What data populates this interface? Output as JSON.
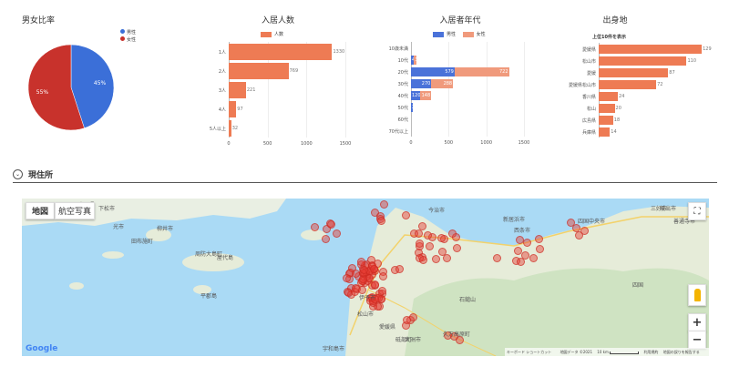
{
  "colors": {
    "male": "#3b6fd8",
    "female": "#c8322c",
    "bar": "#ee7b54",
    "bar_light": "#f09a7c",
    "series_blue": "#4a72d9"
  },
  "gender_panel": {
    "title": "男女比率",
    "legend": [
      "男性",
      "女性"
    ],
    "male_pct_label": "45%",
    "female_pct_label": "55%"
  },
  "residents_panel": {
    "title": "入居人数",
    "legend": "人数"
  },
  "age_panel": {
    "title": "入居者年代",
    "legend": [
      "男性",
      "女性"
    ]
  },
  "origin_panel": {
    "title": "出身地",
    "subtitle": "上位10件を表示"
  },
  "section": {
    "title": "現住所"
  },
  "map": {
    "tab_map": "地図",
    "tab_satellite": "航空写真",
    "google": "Google",
    "footer": [
      "キーボード ショートカット",
      "地図データ ©2021",
      "10 km",
      "利用規約",
      "地図の誤りを報告する"
    ],
    "places": [
      "山口県",
      "下松市",
      "光市",
      "田布施町",
      "柳井市",
      "周防大島町",
      "屋代島",
      "平郡島",
      "松山市",
      "西条市",
      "新居浜市",
      "四国中央市",
      "三好市",
      "愛媛県",
      "石鎚山",
      "今治市",
      "大洲市",
      "久万高原町",
      "四国",
      "坂出市",
      "善通寺市",
      "伊予市",
      "砥部町",
      "宇和島市"
    ]
  },
  "chart_data": [
    {
      "type": "pie",
      "title": "男女比率",
      "labels": [
        "男性",
        "女性"
      ],
      "values": [
        45,
        55
      ]
    },
    {
      "type": "bar",
      "title": "入居人数",
      "orientation": "horizontal",
      "categories": [
        "1人",
        "2人",
        "3人",
        "4人",
        "5人以上"
      ],
      "values": [
        1330,
        769,
        221,
        97,
        32
      ],
      "xlim": [
        0,
        1500
      ],
      "xticks": [
        0,
        500,
        1000,
        1500
      ],
      "series": [
        {
          "name": "人数"
        }
      ]
    },
    {
      "type": "bar",
      "title": "入居者年代",
      "orientation": "horizontal",
      "stacked": true,
      "categories": [
        "10歳未満",
        "10代",
        "20代",
        "30代",
        "40代",
        "50代",
        "60代",
        "70代以上"
      ],
      "series": [
        {
          "name": "男性",
          "values": [
            0,
            41,
            579,
            270,
            120,
            20,
            0,
            0
          ]
        },
        {
          "name": "女性",
          "values": [
            0,
            37,
            722,
            288,
            148,
            0,
            0,
            0
          ]
        }
      ],
      "xlim": [
        0,
        1500
      ],
      "xticks": [
        0,
        500,
        1000,
        1500
      ]
    },
    {
      "type": "bar",
      "title": "出身地",
      "orientation": "horizontal",
      "categories": [
        "愛媛県",
        "松山市",
        "愛媛",
        "愛媛県松山市",
        "香川県",
        "松山",
        "広島県",
        "兵庫県"
      ],
      "values": [
        129,
        110,
        87,
        72,
        24,
        20,
        18,
        14
      ]
    }
  ]
}
